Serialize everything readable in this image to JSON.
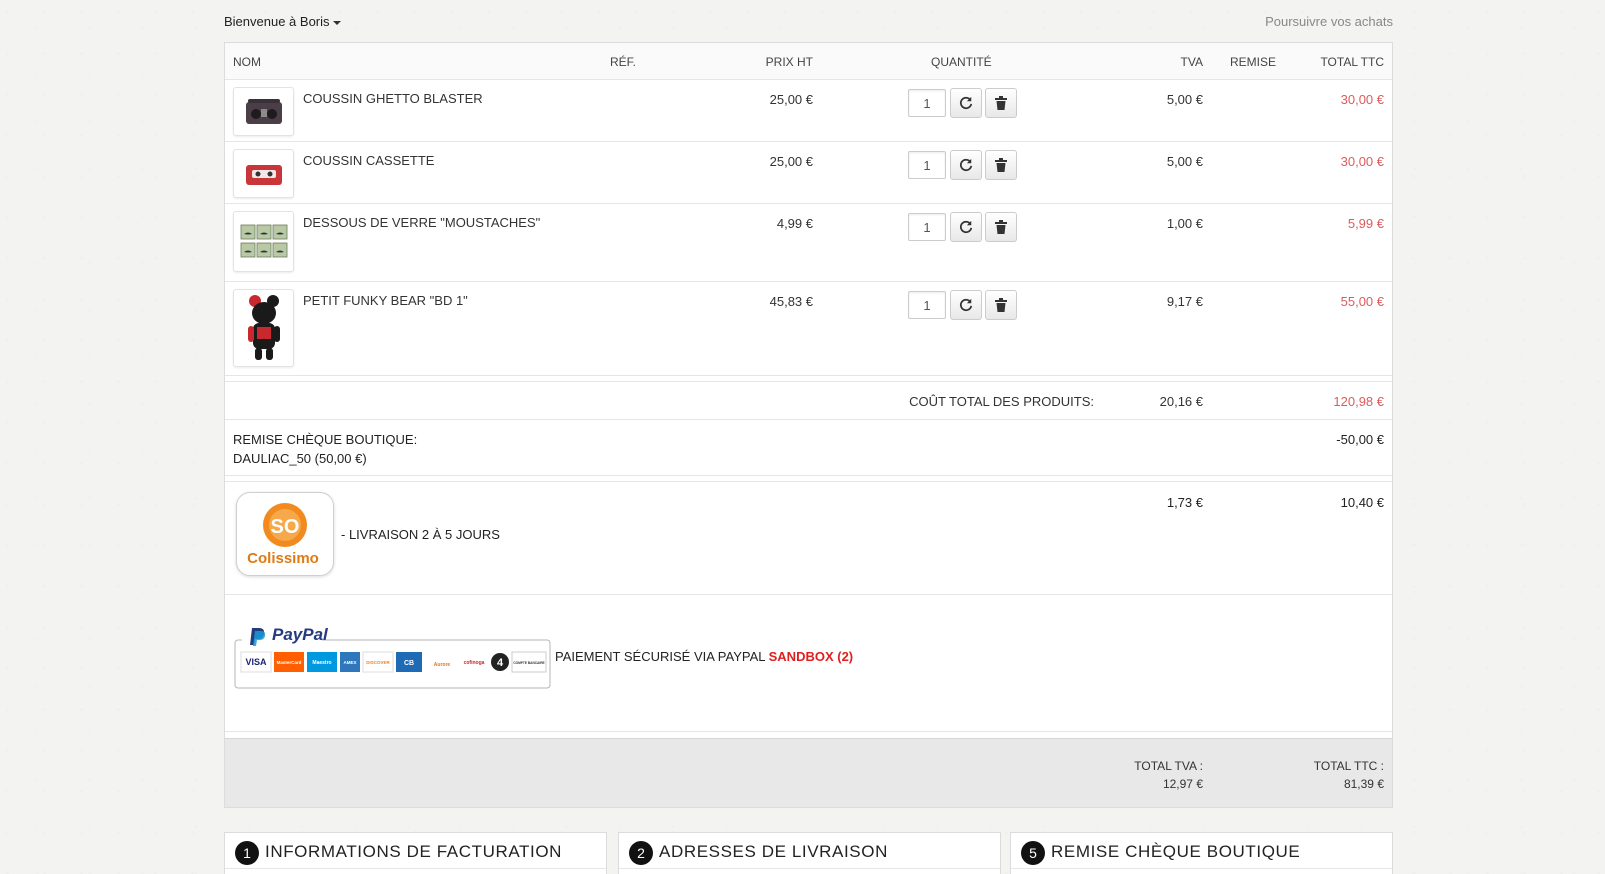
{
  "header": {
    "welcome": "Bienvenue à Boris",
    "continue_link": "Poursuivre vos achats"
  },
  "columns": {
    "nom": "NOM",
    "ref": "RÉF.",
    "prix_ht": "PRIX HT",
    "quantite": "QUANTITÉ",
    "tva": "TVA",
    "remise": "REMISE",
    "total_ttc": "TOTAL TTC"
  },
  "items": [
    {
      "name": "COUSSIN GHETTO BLASTER",
      "price_ht": "25,00 €",
      "qty": "1",
      "tva": "5,00 €",
      "total": "30,00 €"
    },
    {
      "name": "COUSSIN CASSETTE",
      "price_ht": "25,00 €",
      "qty": "1",
      "tva": "5,00 €",
      "total": "30,00 €"
    },
    {
      "name": "DESSOUS DE VERRE \"MOUSTACHES\"",
      "price_ht": "4,99 €",
      "qty": "1",
      "tva": "1,00 €",
      "total": "5,99 €"
    },
    {
      "name": "PETIT FUNKY BEAR \"BD 1\"",
      "price_ht": "45,83 €",
      "qty": "1",
      "tva": "9,17 €",
      "total": "55,00 €"
    }
  ],
  "subtotal": {
    "label": "COÛT TOTAL DES PRODUITS:",
    "tva": "20,16 €",
    "total": "120,98 €"
  },
  "discount": {
    "label": "REMISE CHÈQUE BOUTIQUE:",
    "code": "DAULIAC_50 (50,00 €)",
    "amount": "-50,00 €"
  },
  "shipping": {
    "logo_text": "Colissimo",
    "logo_badge": "SO",
    "label": "- LIVRAISON 2 À 5 JOURS",
    "tva": "1,73 €",
    "total": "10,40 €"
  },
  "payment": {
    "logo_text": "PayPal",
    "label": "PAIEMENT SÉCURISÉ VIA PAYPAL",
    "sandbox": "SANDBOX (2)",
    "cards": [
      "VISA",
      "MasterCard",
      "Maestro",
      "AMEX",
      "DISCOVER",
      "CB",
      "Aurore",
      "cofinoga",
      "4",
      "COMPTE BANCAIRE"
    ]
  },
  "totals": {
    "tva_label": "TOTAL TVA :",
    "tva_value": "12,97 €",
    "ttc_label": "TOTAL TTC :",
    "ttc_value": "81,39 €"
  },
  "steps": [
    {
      "num": "1",
      "title": "INFORMATIONS DE FACTURATION"
    },
    {
      "num": "2",
      "title": "ADRESSES DE LIVRAISON"
    },
    {
      "num": "5",
      "title": "REMISE CHÈQUE BOUTIQUE"
    }
  ],
  "colors": {
    "price_red": "#e05a5a",
    "sandbox_red": "#e02020",
    "totals_bg": "#e8e8e8",
    "paypal_blue": "#253b80",
    "paypal_light": "#179bd7",
    "colissimo_orange": "#f18b1f"
  }
}
